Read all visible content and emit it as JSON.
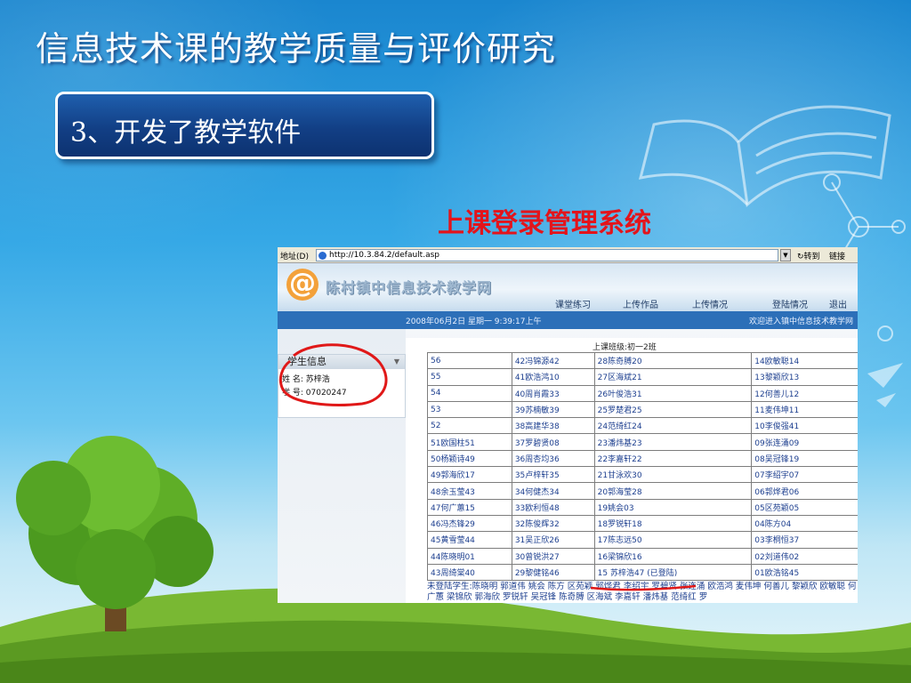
{
  "slide": {
    "title": "信息技术课的教学质量与评价研究",
    "section": "3、开发了教学软件",
    "subtitle": "上课登录管理系统"
  },
  "browser": {
    "address_label": "地址(D)",
    "url": "http://10.3.84.2/default.asp",
    "go_label": "转到",
    "links_label": "链接"
  },
  "site": {
    "logo_text": "陈村镇中信息技术教学网",
    "nav": [
      "课堂练习",
      "上传作品",
      "上传情况",
      "登陆情况",
      "退出"
    ],
    "date_line": "2008年06月2日   星期一   9:39:17上午",
    "welcome": "欢迎进入镇中信息技术教学网"
  },
  "student_panel": {
    "title": "学生信息",
    "name_label": "姓    名:",
    "name_value": "苏梓浩",
    "id_label": "学    号:",
    "id_value": "07020247"
  },
  "class_table": {
    "title": "上课班级:初一2班",
    "rows": [
      [
        "56",
        "42冯锦源42",
        "28陈奇膊20",
        "14欧敏聪14"
      ],
      [
        "55",
        "41欧浩鸿10",
        "27区海斌21",
        "13黎颖欣13"
      ],
      [
        "54",
        "40周肖霞33",
        "26叶俊浩31",
        "12何善儿12"
      ],
      [
        "53",
        "39苏楠敏39",
        "25罗楚君25",
        "11麦伟坤11"
      ],
      [
        "52",
        "38高建华38",
        "24范绮红24",
        "10李俊强41"
      ],
      [
        "51欧国柱51",
        "37罗碧贤08",
        "23潘炜基23",
        "09张连涌09"
      ],
      [
        "50杨颖诗49",
        "36周杏均36",
        "22李嘉轩22",
        "08吴冠锋19"
      ],
      [
        "49郭海欣17",
        "35卢梓轩35",
        "21甘泳欢30",
        "07李绍宇07"
      ],
      [
        "48余玉莹43",
        "34何健杰34",
        "20郭海莹28",
        "06郭烨君06"
      ],
      [
        "47何广蕙15",
        "33欧利恒48",
        "19姚会03",
        "05区苑颖05"
      ],
      [
        "46冯杰锋29",
        "32陈俊辉32",
        "18罗锐轩18",
        "04陈方04"
      ],
      [
        "45黄雪莹44",
        "31吴正欣26",
        "17陈志远50",
        "03李桐恒37"
      ],
      [
        "44陈晓明01",
        "30曾锐洪27",
        "16梁锦欣16",
        "02刘道伟02"
      ],
      [
        "43周绮棠40",
        "29黎健铭46",
        "15  苏梓浩47 (已登陆)",
        "01欧浩铭45"
      ]
    ]
  },
  "absent": {
    "label": "未登陆学生:",
    "names": "陈晓明 郭道伟 姚会 陈方 区苑颖 郭烨君 李绍宇 罗碧贤 张连涌 欧浩鸿 麦伟坤 何善儿 黎颖欣 欧敏聪 何广蕙 梁锦欣 郭海欣 罗锐轩 吴冠锋 陈奇膊 区海斌 李嘉轩 潘炜基 范绮红 罗"
  }
}
